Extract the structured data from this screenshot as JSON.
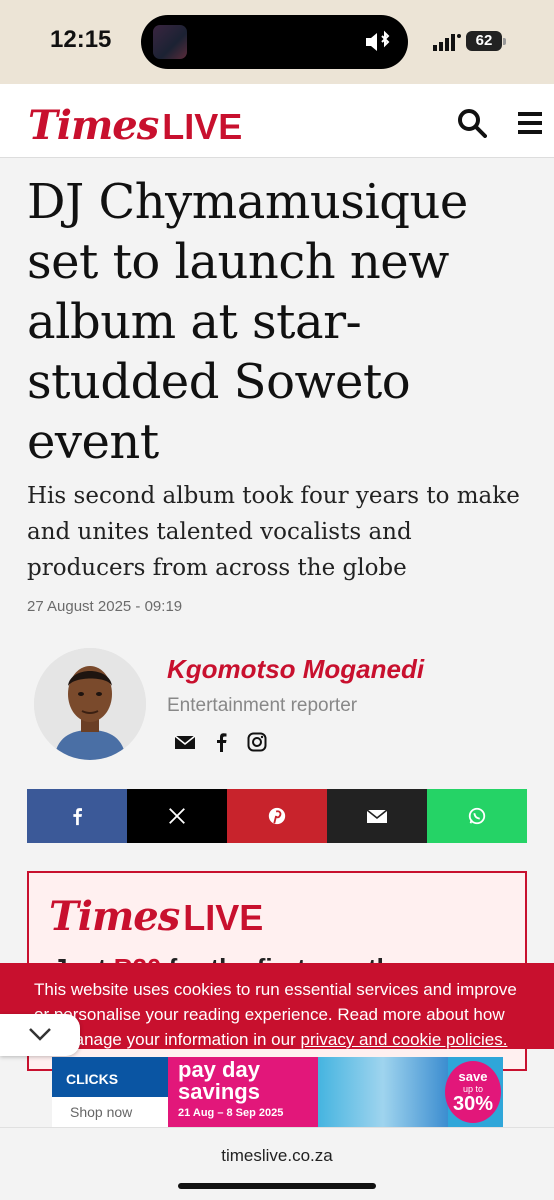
{
  "status": {
    "time": "12:15",
    "battery": "62"
  },
  "header": {
    "logo_times": "Times",
    "logo_live": "LIVE"
  },
  "article": {
    "headline": "DJ Chymamusique set to launch new album at star-studded Soweto event",
    "standfirst": "His second album took four years to make and unites talented vocalists and producers from across the globe",
    "date": "27 August 2025 - 09:19"
  },
  "author": {
    "name": "Kgomotso Moganedi",
    "role": "Entertainment reporter"
  },
  "share": {
    "facebook_color": "#3b5998",
    "x_color": "#000000",
    "pinterest_color": "#c8232c",
    "email_color": "#222222",
    "whatsapp_color": "#25d366"
  },
  "promo": {
    "logo_times": "Times",
    "logo_live": "LIVE",
    "text_prefix": "Just ",
    "price": "R20",
    "text_suffix": " for the first month"
  },
  "cookie": {
    "text": "This website uses cookies to run essential services and improve or personalise your reading experience. Read more about how we manage your information in our ",
    "link": "privacy and cookie policies."
  },
  "ad": {
    "brand": "CLICKS",
    "shop": "Shop now",
    "title_1": "pay day",
    "title_2": "savings",
    "dates": "21 Aug – 8 Sep 2025",
    "save": "save",
    "upto": "up to",
    "pct": "30%"
  },
  "browser": {
    "url": "timeslive.co.za"
  },
  "colors": {
    "brand_red": "#c8102e"
  }
}
